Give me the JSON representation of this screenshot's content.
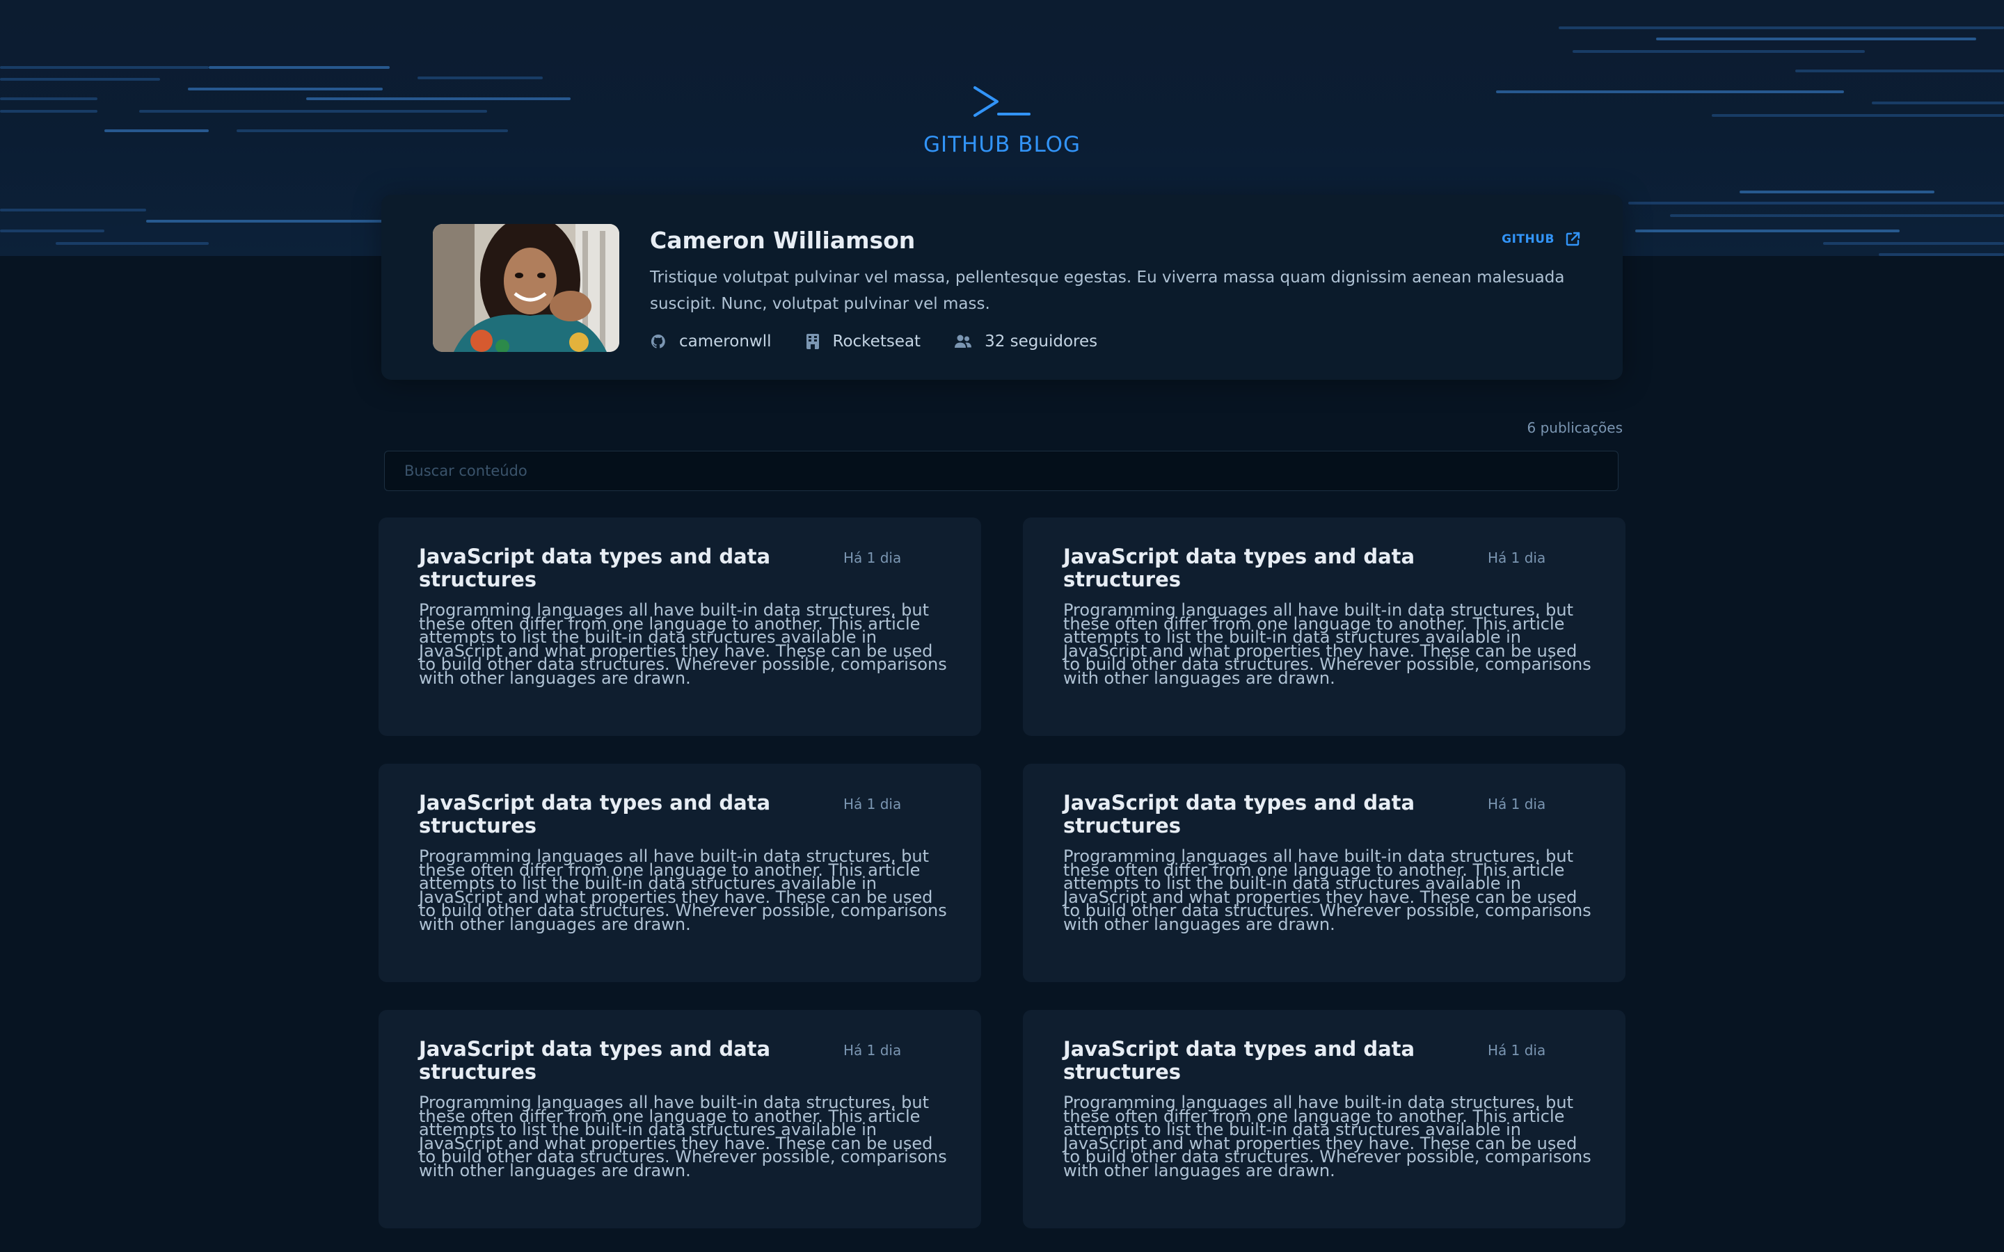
{
  "brand": {
    "title": "GITHUB BLOG",
    "color": "#3294F8",
    "icon": "terminal-prompt-icon"
  },
  "profile": {
    "name": "Cameron Williamson",
    "link_label": "GITHUB",
    "link_icon": "external-link-icon",
    "bio": "Tristique volutpat pulvinar vel massa, pellentesque egestas. Eu viverra massa quam dignissim aenean malesuada suscipit. Nunc, volutpat pulvinar vel mass.",
    "meta": [
      {
        "icon": "github-icon",
        "label": "cameronwll"
      },
      {
        "icon": "building-icon",
        "label": "Rocketseat"
      },
      {
        "icon": "users-icon",
        "label": "32 seguidores"
      }
    ]
  },
  "publications": {
    "title": "",
    "count_label": "6 publicações"
  },
  "search": {
    "placeholder": "Buscar conteúdo",
    "value": ""
  },
  "posts": [
    {
      "title": "JavaScript data types and data structures",
      "date": "Há 1 dia",
      "excerpt": "Programming languages all have built-in data structures, but these often differ from one language to another. This article attempts to list the built-in data structures available in JavaScript and what properties they have. These can be used to build other data structures. Wherever possible, comparisons with other languages are drawn."
    },
    {
      "title": "JavaScript data types and data structures",
      "date": "Há 1 dia",
      "excerpt": "Programming languages all have built-in data structures, but these often differ from one language to another. This article attempts to list the built-in data structures available in JavaScript and what properties they have. These can be used to build other data structures. Wherever possible, comparisons with other languages are drawn."
    },
    {
      "title": "JavaScript data types and data structures",
      "date": "Há 1 dia",
      "excerpt": "Programming languages all have built-in data structures, but these often differ from one language to another. This article attempts to list the built-in data structures available in JavaScript and what properties they have. These can be used to build other data structures. Wherever possible, comparisons with other languages are drawn."
    },
    {
      "title": "JavaScript data types and data structures",
      "date": "Há 1 dia",
      "excerpt": "Programming languages all have built-in data structures, but these often differ from one language to another. This article attempts to list the built-in data structures available in JavaScript and what properties they have. These can be used to build other data structures. Wherever possible, comparisons with other languages are drawn."
    },
    {
      "title": "JavaScript data types and data structures",
      "date": "Há 1 dia",
      "excerpt": "Programming languages all have built-in data structures, but these often differ from one language to another. This article attempts to list the built-in data structures available in JavaScript and what properties they have. These can be used to build other data structures. Wherever possible, comparisons with other languages are drawn."
    },
    {
      "title": "JavaScript data types and data structures",
      "date": "Há 1 dia",
      "excerpt": "Programming languages all have built-in data structures, but these often differ from one language to another. This article attempts to list the built-in data structures available in JavaScript and what properties they have. These can be used to build other data structures. Wherever possible, comparisons with other languages are drawn."
    }
  ],
  "colors": {
    "background": "#071422",
    "profile": "#0B1B2B",
    "card": "#0F1E2F",
    "title": "#E7EDF4",
    "text": "#AFC2D4",
    "muted": "#7B96B2"
  }
}
